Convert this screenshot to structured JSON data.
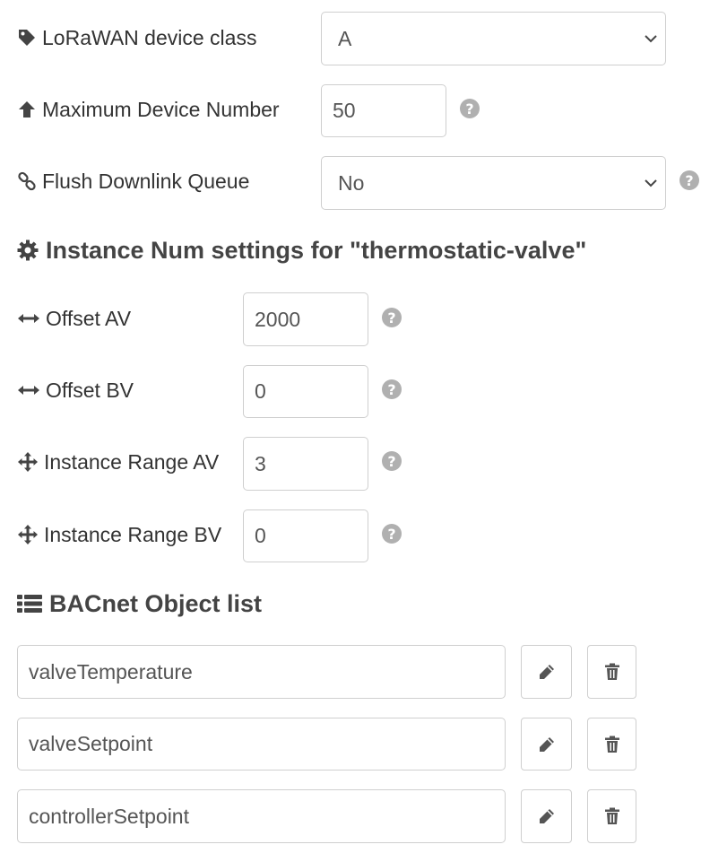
{
  "device_class": {
    "label": "LoRaWAN device class",
    "value": "A"
  },
  "max_devices": {
    "label": "Maximum Device Number",
    "value": "50"
  },
  "flush_queue": {
    "label": "Flush Downlink Queue",
    "value": "No"
  },
  "instance_section": {
    "title": "Instance Num settings for \"thermostatic-valve\"",
    "fields": [
      {
        "label": "Offset AV",
        "value": "2000",
        "icon": "arrows-h-icon"
      },
      {
        "label": "Offset BV",
        "value": "0",
        "icon": "arrows-h-icon"
      },
      {
        "label": "Instance Range AV",
        "value": "3",
        "icon": "arrows-icon"
      },
      {
        "label": "Instance Range BV",
        "value": "0",
        "icon": "arrows-icon"
      }
    ]
  },
  "object_list": {
    "title": "BACnet Object list",
    "items": [
      {
        "value": "valveTemperature"
      },
      {
        "value": "valveSetpoint"
      },
      {
        "value": "controllerSetpoint"
      }
    ]
  },
  "help_glyph": "?",
  "colors": {
    "text": "#333333",
    "help": "#b0b0b0",
    "border": "#cfcfcf"
  }
}
